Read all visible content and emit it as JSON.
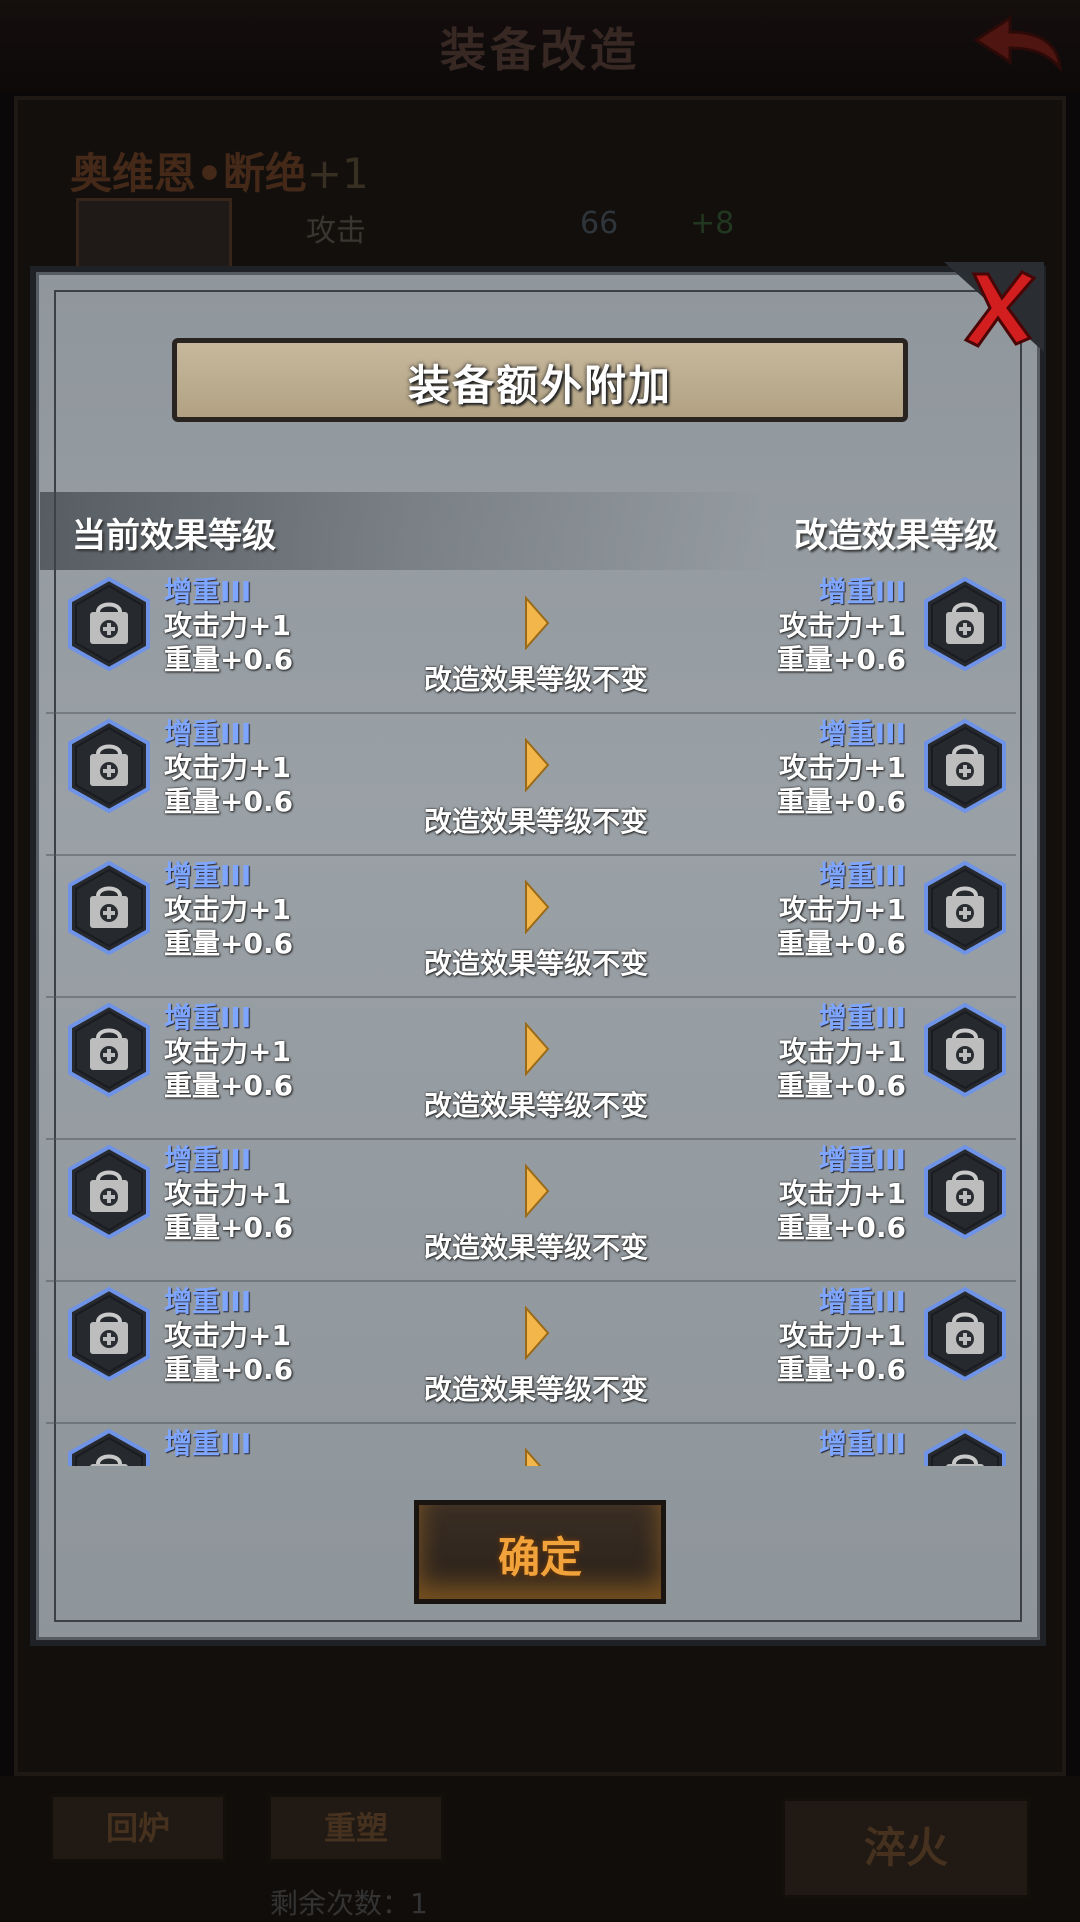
{
  "background": {
    "title": "装备改造",
    "item_name": "奥维恩•断绝",
    "item_plus": "+1",
    "stat_label": "攻击",
    "stat_value": "66",
    "stat_add": "+8",
    "buttons": {
      "recast": "回炉",
      "reshape": "重塑",
      "temper": "淬火"
    },
    "remain_text": "剩余次数：1"
  },
  "modal": {
    "title": "装备额外附加",
    "col_current": "当前效果等级",
    "col_modified": "改造效果等级",
    "unchanged_text": "改造效果等级不变",
    "confirm_label": "确定",
    "rows": [
      {
        "name": "增重III",
        "line1": "攻击力+1",
        "line2": "重量+0.6"
      },
      {
        "name": "增重III",
        "line1": "攻击力+1",
        "line2": "重量+0.6"
      },
      {
        "name": "增重III",
        "line1": "攻击力+1",
        "line2": "重量+0.6"
      },
      {
        "name": "增重III",
        "line1": "攻击力+1",
        "line2": "重量+0.6"
      },
      {
        "name": "增重III",
        "line1": "攻击力+1",
        "line2": "重量+0.6"
      },
      {
        "name": "增重III",
        "line1": "攻击力+1",
        "line2": "重量+0.6"
      },
      {
        "name": "增重III",
        "line1": "",
        "line2": ""
      }
    ]
  },
  "colors": {
    "accent_blue": "#7fa6ff",
    "confirm_orange": "#f2a23a",
    "close_red": "#d21e1e"
  },
  "icons": {
    "effect": "weight-bag-icon",
    "arrow": "chevron-right-icon",
    "close": "close-x-icon",
    "back": "back-arrow-icon"
  }
}
